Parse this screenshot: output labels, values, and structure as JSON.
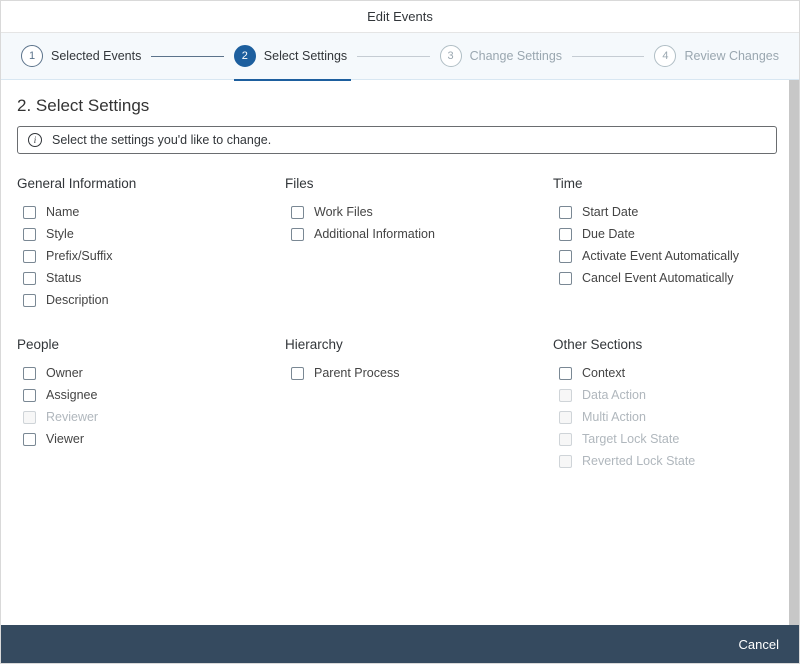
{
  "title": "Edit Events",
  "steps": [
    {
      "num": "1",
      "label": "Selected Events"
    },
    {
      "num": "2",
      "label": "Select Settings"
    },
    {
      "num": "3",
      "label": "Change Settings"
    },
    {
      "num": "4",
      "label": "Review Changes"
    }
  ],
  "section_heading": "2. Select Settings",
  "info_text": "Select the settings you'd like to change.",
  "groups_row1": {
    "general": {
      "title": "General Information",
      "items": [
        {
          "label": "Name",
          "enabled": true
        },
        {
          "label": "Style",
          "enabled": true
        },
        {
          "label": "Prefix/Suffix",
          "enabled": true
        },
        {
          "label": "Status",
          "enabled": true
        },
        {
          "label": "Description",
          "enabled": true
        }
      ]
    },
    "files": {
      "title": "Files",
      "items": [
        {
          "label": "Work Files",
          "enabled": true
        },
        {
          "label": "Additional Information",
          "enabled": true
        }
      ]
    },
    "time": {
      "title": "Time",
      "items": [
        {
          "label": "Start Date",
          "enabled": true
        },
        {
          "label": "Due Date",
          "enabled": true
        },
        {
          "label": "Activate Event Automatically",
          "enabled": true
        },
        {
          "label": "Cancel Event Automatically",
          "enabled": true
        }
      ]
    }
  },
  "groups_row2": {
    "people": {
      "title": "People",
      "items": [
        {
          "label": "Owner",
          "enabled": true
        },
        {
          "label": "Assignee",
          "enabled": true
        },
        {
          "label": "Reviewer",
          "enabled": false
        },
        {
          "label": "Viewer",
          "enabled": true
        }
      ]
    },
    "hierarchy": {
      "title": "Hierarchy",
      "items": [
        {
          "label": "Parent Process",
          "enabled": true
        }
      ]
    },
    "other": {
      "title": "Other Sections",
      "items": [
        {
          "label": "Context",
          "enabled": true
        },
        {
          "label": "Data Action",
          "enabled": false
        },
        {
          "label": "Multi Action",
          "enabled": false
        },
        {
          "label": "Target Lock State",
          "enabled": false
        },
        {
          "label": "Reverted Lock State",
          "enabled": false
        }
      ]
    }
  },
  "footer": {
    "cancel": "Cancel"
  }
}
